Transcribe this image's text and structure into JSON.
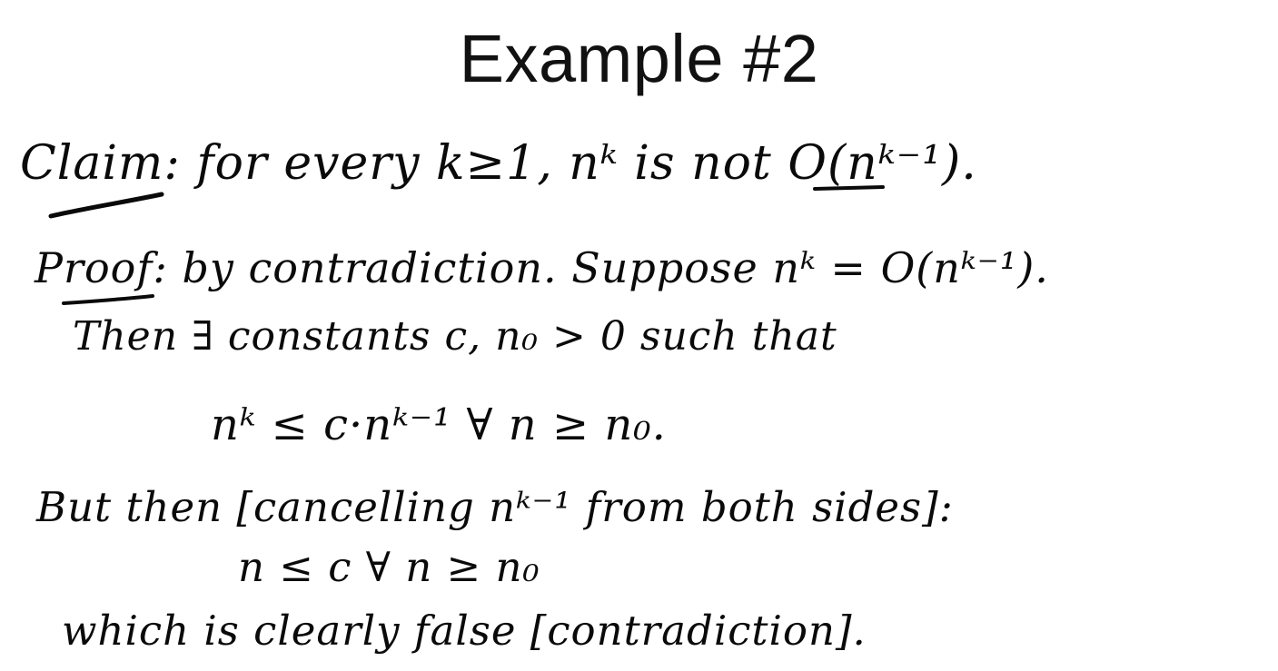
{
  "slide": {
    "title": "Example #2",
    "lines": {
      "claim": "Claim: for every k≥1, nᵏ is not O(nᵏ⁻¹).",
      "proof": "Proof: by contradiction. Suppose nᵏ = O(nᵏ⁻¹).",
      "then": "Then ∃ constants c, n₀ > 0  such that",
      "ineq1": "nᵏ ≤ c·nᵏ⁻¹    ∀ n ≥ n₀.",
      "but": "But then [cancelling nᵏ⁻¹ from both sides]:",
      "ineq2": "n ≤ c    ∀ n ≥ n₀",
      "which": "which is clearly false [contradiction]."
    }
  }
}
